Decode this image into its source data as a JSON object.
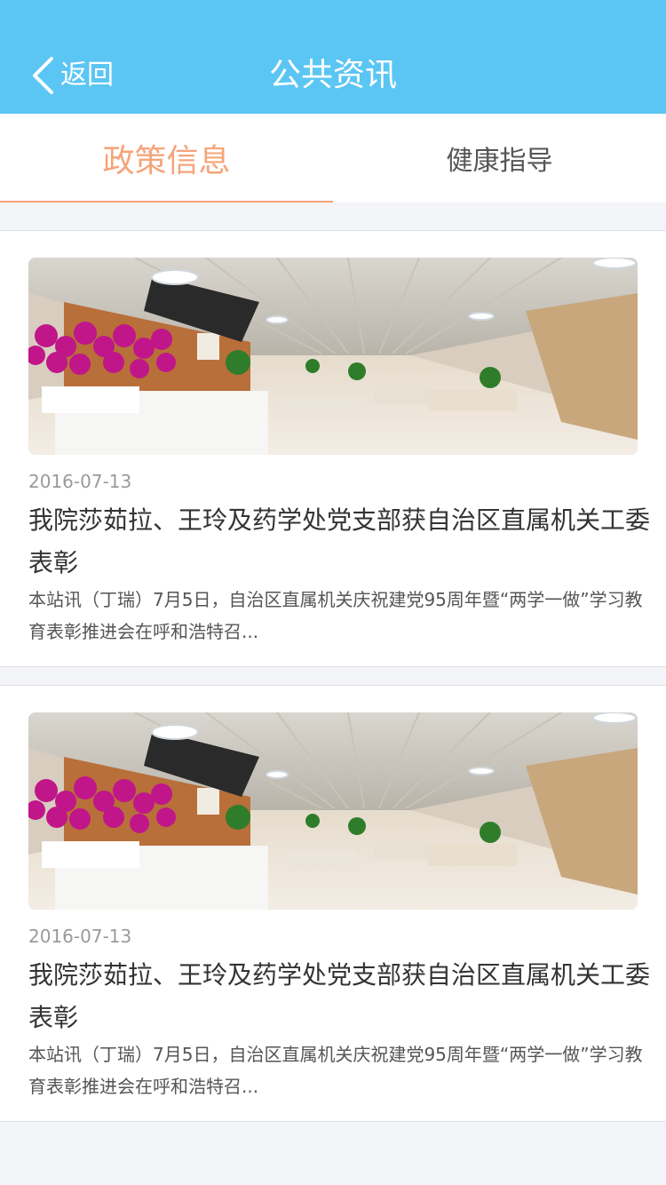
{
  "header": {
    "back_label": "返回",
    "title": "公共资讯"
  },
  "tabs": [
    {
      "label": "政策信息",
      "active": true
    },
    {
      "label": "健康指导",
      "active": false
    }
  ],
  "colors": {
    "header_bg": "#5bc6f3",
    "active_tab": "#f5a47a",
    "page_bg": "#f4f5f9"
  },
  "articles": [
    {
      "image_alt": "hospital lobby photo",
      "date": "2016-07-13",
      "title": "我院莎茹拉、王玲及药学处党支部获自治区直属机关工委表彰",
      "summary": "本站讯（丁瑞）7月5日，自治区直属机关庆祝建党95周年暨“两学一做”学习教育表彰推进会在呼和浩特召..."
    },
    {
      "image_alt": "hospital lobby photo",
      "date": "2016-07-13",
      "title": "我院莎茹拉、王玲及药学处党支部获自治区直属机关工委表彰",
      "summary": "本站讯（丁瑞）7月5日，自治区直属机关庆祝建党95周年暨“两学一做”学习教育表彰推进会在呼和浩特召..."
    }
  ]
}
